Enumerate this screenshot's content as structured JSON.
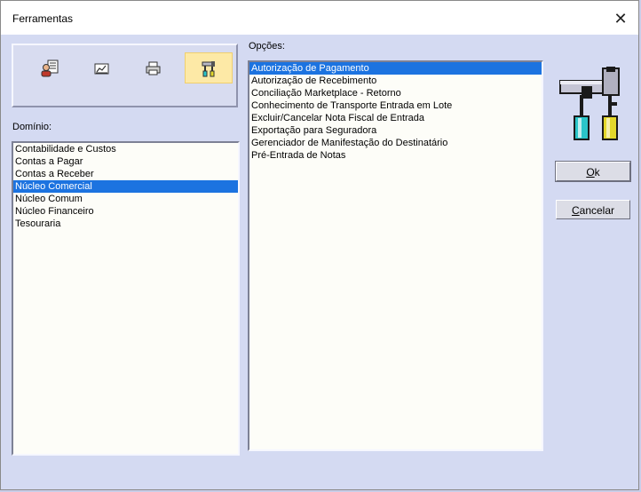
{
  "window": {
    "title": "Ferramentas"
  },
  "toolbar": {
    "icons": [
      "user-document-icon",
      "chart-document-icon",
      "printer-icon",
      "tools-icon"
    ],
    "active_index": 3
  },
  "dominio": {
    "label": "Domínio:",
    "items": [
      "Contabilidade e Custos",
      "Contas a Pagar",
      "Contas a Receber",
      "Núcleo Comercial",
      "Núcleo Comum",
      "Núcleo Financeiro",
      "Tesouraria"
    ],
    "selected_index": 3
  },
  "opcoes": {
    "label": "Opções:",
    "items": [
      "Autorização de Pagamento",
      "Autorização de Recebimento",
      "Conciliação Marketplace - Retorno",
      "Conhecimento de Transporte Entrada em Lote",
      "Excluir/Cancelar Nota Fiscal de Entrada",
      "Exportação para Seguradora",
      "Gerenciador de Manifestação do Destinatário",
      "Pré-Entrada de Notas"
    ],
    "selected_index": 0
  },
  "buttons": {
    "ok_accel": "O",
    "ok_rest": "k",
    "cancel_accel": "C",
    "cancel_rest": "ancelar"
  },
  "colors": {
    "selection": "#1c73e0",
    "dialog_bg": "#d4daf2",
    "active_tool": "#fde9a6"
  }
}
